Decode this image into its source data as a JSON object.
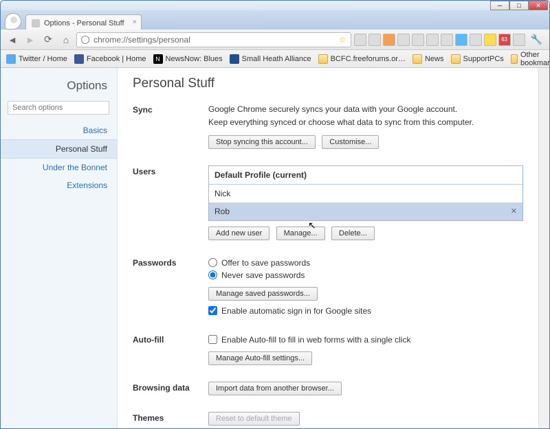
{
  "window": {
    "tab_title": "Options - Personal Stuff",
    "url": "chrome://settings/personal"
  },
  "bookmarks": {
    "items": [
      {
        "label": "Twitter / Home",
        "icon": "tw"
      },
      {
        "label": "Facebook | Home",
        "icon": "fb"
      },
      {
        "label": "NewsNow: Blues",
        "icon": "nn"
      },
      {
        "label": "Small Heath Alliance",
        "icon": "sh"
      },
      {
        "label": "BCFC.freeforums.or…",
        "icon": "fld"
      },
      {
        "label": "News",
        "icon": "fld"
      },
      {
        "label": "SupportPCs",
        "icon": "fld"
      }
    ],
    "other": "Other bookmarks"
  },
  "toolbar_tip_count": "63",
  "sidebar": {
    "title": "Options",
    "search_placeholder": "Search options",
    "items": [
      "Basics",
      "Personal Stuff",
      "Under the Bonnet",
      "Extensions"
    ],
    "active_index": 1
  },
  "page": {
    "title": "Personal Stuff",
    "sync": {
      "label": "Sync",
      "line1": "Google Chrome securely syncs your data with your Google account.",
      "line2": "Keep everything synced or choose what data to sync from this computer.",
      "btn_stop": "Stop syncing this account...",
      "btn_customise": "Customise..."
    },
    "users": {
      "label": "Users",
      "header": "Default Profile (current)",
      "rows": [
        "Nick",
        "Rob"
      ],
      "selected_index": 1,
      "btn_add": "Add new user",
      "btn_manage": "Manage...",
      "btn_delete": "Delete..."
    },
    "passwords": {
      "label": "Passwords",
      "opt_offer": "Offer to save passwords",
      "opt_never": "Never save passwords",
      "selected": "never",
      "btn_manage": "Manage saved passwords...",
      "chk_autosignin": "Enable automatic sign in for Google sites",
      "chk_autosignin_checked": true
    },
    "autofill": {
      "label": "Auto-fill",
      "chk_enable": "Enable Auto-fill to fill in web forms with a single click",
      "chk_enable_checked": false,
      "btn_manage": "Manage Auto-fill settings..."
    },
    "browsing": {
      "label": "Browsing data",
      "btn_import": "Import data from another browser..."
    },
    "themes": {
      "label": "Themes",
      "btn_reset": "Reset to default theme"
    }
  }
}
